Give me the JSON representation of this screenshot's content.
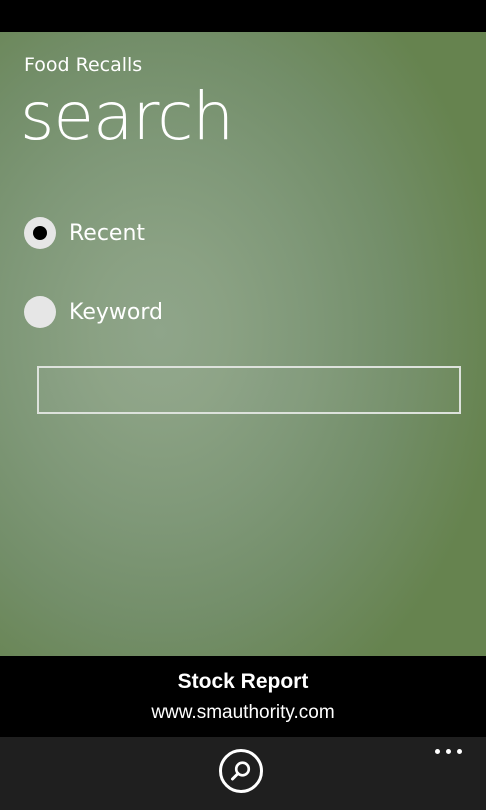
{
  "app": {
    "title": "Food Recalls",
    "page_title": "search"
  },
  "search_options": [
    {
      "label": "Recent",
      "selected": true
    },
    {
      "label": "Keyword",
      "selected": false
    }
  ],
  "search_input": {
    "value": "",
    "placeholder": ""
  },
  "ad": {
    "title": "Stock Report",
    "url": "www.smauthority.com"
  },
  "app_bar": {
    "buttons": [
      {
        "icon": "search-icon"
      }
    ],
    "more_icon": "ellipsis-icon"
  },
  "colors": {
    "background_light": "#8fa58a",
    "background_dark": "#66834f",
    "radio_fill": "#e6e6e6",
    "app_bar": "#1f1f1f"
  }
}
